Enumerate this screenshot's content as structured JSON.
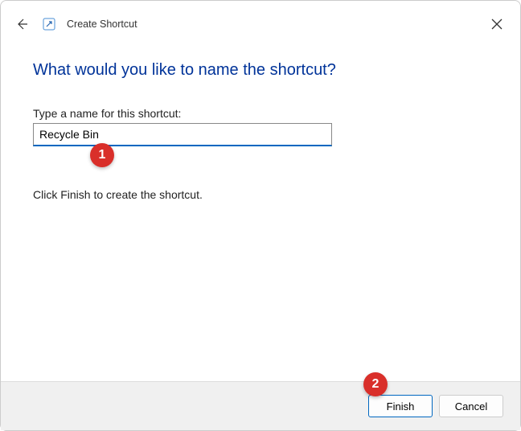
{
  "titlebar": {
    "title": "Create Shortcut"
  },
  "main": {
    "heading": "What would you like to name the shortcut?",
    "input_label": "Type a name for this shortcut:",
    "input_value": "Recycle Bin",
    "hint": "Click Finish to create the shortcut."
  },
  "footer": {
    "finish_label": "Finish",
    "cancel_label": "Cancel"
  },
  "annotations": {
    "a1": "1",
    "a2": "2"
  }
}
